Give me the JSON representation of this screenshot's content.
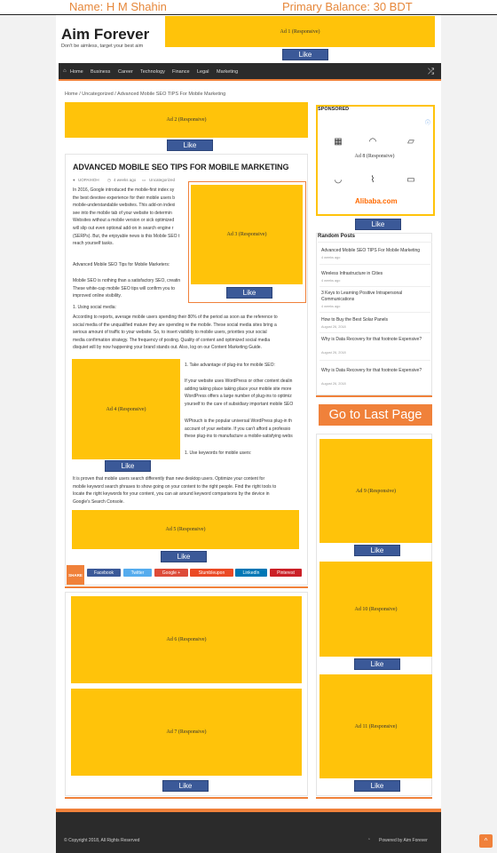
{
  "topbar": {
    "name": "Name: H M Shahin",
    "balance": "Primary Balance: 30 BDT"
  },
  "site": {
    "title": "Aim Forever",
    "tagline": "Don't be aimless, target your best aim"
  },
  "like_label": "Like",
  "ads": {
    "ad1": "Ad 1 (Responsive)",
    "ad2": "Ad 2 (Responsive)",
    "ad3": "Ad 3 (Responsive)",
    "ad4": "Ad 4 (Responsive)",
    "ad5": "Ad 5 (Responsive)",
    "ad6": "Ad 6 (Responsive)",
    "ad7": "Ad 7 (Responsive)",
    "ad8": "Ad 8 (Responsive)",
    "ad9": "Ad 9 (Responsive)",
    "ad10": "Ad 10 (Responsive)",
    "ad11": "Ad 11 (Responsive)"
  },
  "nav": {
    "items": [
      "Home",
      "Business",
      "Career",
      "Technology",
      "Finance",
      "Legal",
      "Marketing"
    ]
  },
  "breadcrumb": {
    "home": "Home",
    "sep": "/",
    "cat": "Uncategorized",
    "current": "Advanced Mobile SEO TIPS For Mobile Marketing"
  },
  "post": {
    "title": "Advanced Mobile SEO Tips For Mobile Marketing",
    "author": "UOPAIHOH",
    "date": "4 weeks ago",
    "category": "Uncategorized",
    "para1": [
      "In 2016, Google introduced the mobile-first index sy",
      "the best devotee experience for their mobile users b",
      "mobile-understandable websites. This add-on indexi",
      "see into the mobile tab of your website to determin",
      "Websites without a mobile version or sick optimized",
      "will slip out even optional add-on in search engine r",
      "(SERPs). But, the enjoyable news is this Mobile SEO t",
      "reach yourself tasks."
    ],
    "para2": "Advanced Mobile SEO Tips for Mobile Marketers:",
    "para3": [
      "Mobile SEO is nothing than a satisfactory SEO, creatin",
      "These white-cap mobile SEO tips will confirm you to",
      "improved online visibility."
    ],
    "item1": "1. Using social media:",
    "para4": [
      "According to reports, average mobile users spending their 80% of the period as soon as the reference to",
      "social media of the unqualified mature they are spending re the mobile. These social media sites bring a",
      "serious amount of traffic to your website. So, to insert visibility to mobile users, priorities your social",
      "media confirmation strategy. The frequency of posting. Quality of content and optimized social media",
      "disquiet will by now happening your brand stands out. Also, log on our Content Marketing Guide."
    ],
    "item2": "1. Take advantage of plug-ins for mobile SEO:",
    "para5": [
      "If your website uses WordPress or other content dealin",
      "adding taking place taking place your mobile site more",
      "WordPress offers a large number of plug-ins to optimiz",
      "yourself to the care of subsidiary important mobile SEO"
    ],
    "para6": [
      "WPtouch is the popular universal WordPress plug-in th",
      "account of your website. If you can't afford a professio",
      "these plug-ins to manufacture a mobile-satisfying webs"
    ],
    "item3": "1. Use keywords for mobile users:",
    "para7": [
      "It is proven that mobile users search differently than new desktop users. Optimize your content for",
      "mobile keyword search phrases to show going on your content to the right people. Find the right tools to",
      "locate the right keywords for your content, you can air around keyword comparisons by the device in",
      "Google's Search Console."
    ]
  },
  "share": {
    "label": "SHARE",
    "buttons": [
      "Facebook",
      "Twitter",
      "Google +",
      "Stumbleupon",
      "LinkedIn",
      "Pinterest"
    ],
    "colors": [
      "#3b5998",
      "#55acee",
      "#dd4b39",
      "#eb4924",
      "#0077b5",
      "#cb2027"
    ]
  },
  "sidebar": {
    "sponsored_title": "SPONSORED",
    "sponsor_brand": "Alibaba.com",
    "random_title": "Random Posts",
    "random_posts": [
      {
        "title": "Advanced Mobile SEO TIPS For Mobile Marketing",
        "date": "4 weeks ago"
      },
      {
        "title": "Wireless Infrastructure in Cities",
        "date": "4 weeks ago"
      },
      {
        "title": "3 Keys to Learning Positive Intrapersonal Communications",
        "date": "4 weeks ago"
      },
      {
        "title": "How to Buy the Best Solar Panels",
        "date": "August 26, 2018"
      },
      {
        "title": "Why is Data Recovery for that footnote Expensive?",
        "date": "August 26, 2018"
      },
      {
        "title": "Why is Data Recovery for that footnote Expensive?",
        "date": "August 26, 2018"
      }
    ],
    "cta": "Go to Last Page"
  },
  "footer": {
    "copyright": "© Copyright 2018, All Rights Reserved",
    "powered": "Powered by Aim Forever"
  }
}
